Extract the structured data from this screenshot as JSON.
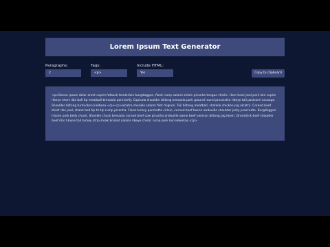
{
  "header": {
    "title": "Lorem Ipsum Text Generator"
  },
  "controls": {
    "paragraphs": {
      "label": "Paragraphs:",
      "value": "2"
    },
    "tags": {
      "label": "Tags:",
      "value": "<p>"
    },
    "include_html": {
      "label": "Include HTML:",
      "value": "Yes"
    },
    "copy_button": "Copy to clipboard"
  },
  "output": {
    "text": "<p>Bacon ipsum dolor amet cupim fatback tenderloin burgdoggen, flank rump salami sirloin picanha tongue chislic. Ham hock jowl pork loin cupim ribeye short ribs ball tip meatball bresaola pork belly. Capicola shoulder biltong bresaola pork ground round prosciutto ribeye tail pastrami sausage. Shoulder biltong turducken kielbasa.</p><p>alcatra shankle salami filet mignon. Tail biltong meatball, shankle chicken pig alcatra. Corned beef short ribs jowl, shank ball tip tri-tip rump picanha. Flank turkey porchetta sirloin, corned beef bacon andouille shoulder jerky prosciutto. Burgdoggen t-bone pork belly chuck. Shankle chuck bresaola corned beef cow picanha andouille swine beef venison biltong pig kevin. Drumstick beef shoulder beef ribs t-bone tail turkey strip steak brisket salami ribeye chislic rump pork loin leberkas.</p>"
  },
  "colors": {
    "page_background": "#0e1732",
    "panel": "#3d4a7b",
    "text": "#ffffff"
  }
}
